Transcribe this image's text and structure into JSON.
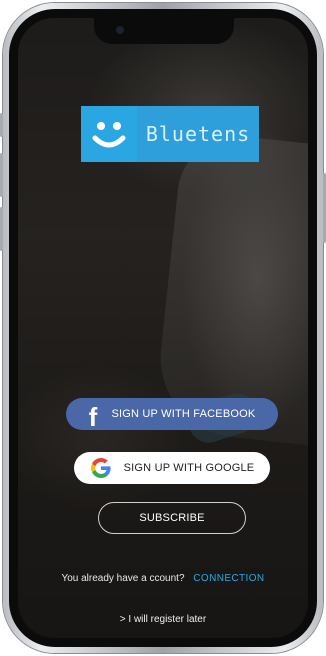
{
  "app": {
    "logo_text": "Bluetens"
  },
  "buttons": {
    "facebook_label": "SIGN UP WITH FACEBOOK",
    "google_label": "SIGN UP WITH GOOGLE",
    "subscribe_label": "SUBSCRIBE"
  },
  "footer": {
    "account_prompt": "You already have a ccount?",
    "connection_link": "CONNECTION",
    "register_later": "> I will register later"
  },
  "icons": {
    "logo": "smiley-icon",
    "facebook": "facebook-icon",
    "google": "google-icon"
  },
  "colors": {
    "brand_blue": "#2aa7e3",
    "facebook_blue": "#4a67a7",
    "link_blue": "#2aa7e3"
  }
}
